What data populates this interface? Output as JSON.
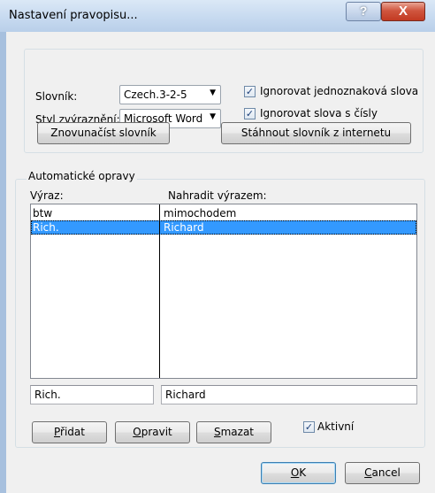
{
  "window": {
    "title": "Nastavení pravopisu...",
    "help_glyph": "?",
    "close_glyph": "X"
  },
  "spelling": {
    "dictionary_label": "Slovník:",
    "dictionary_value": "Czech.3-2-5",
    "highlight_label": "Styl zvýraznění:",
    "highlight_value": "Microsoft Word",
    "ignore_single_letter_label": "Ignorovat jednoznaková slova",
    "ignore_single_letter_checked": true,
    "ignore_numbers_label": "Ignorovat slova s čísly",
    "ignore_numbers_checked": true,
    "reload_button": "Znovunačíst slovník",
    "download_button": "Stáhnout slovník z internetu"
  },
  "autocorrect": {
    "group_label": "Automatické opravy",
    "col_expression": "Výraz:",
    "col_replace": "Nahradit výrazem:",
    "rows": [
      {
        "expression": "btw",
        "replacement": "mimochodem",
        "selected": false
      },
      {
        "expression": "Rich.",
        "replacement": "Richard",
        "selected": true
      }
    ],
    "expression_input": "Rich.",
    "replacement_input": "Richard",
    "add_underline": "P",
    "add_rest": "řidat",
    "edit_underline": "O",
    "edit_rest": "pravit",
    "delete_underline": "S",
    "delete_rest": "mazat",
    "active_label": "Aktivní",
    "active_checked": true
  },
  "footer": {
    "ok_underline": "O",
    "ok_rest": "K",
    "cancel_underline": "C",
    "cancel_rest": "ancel"
  },
  "icons": {
    "check": "✓",
    "dropdown": "▼"
  },
  "colors": {
    "selection": "#3399ff",
    "dialog_bg": "#f0f0f0",
    "close_red": "#c23a22"
  }
}
